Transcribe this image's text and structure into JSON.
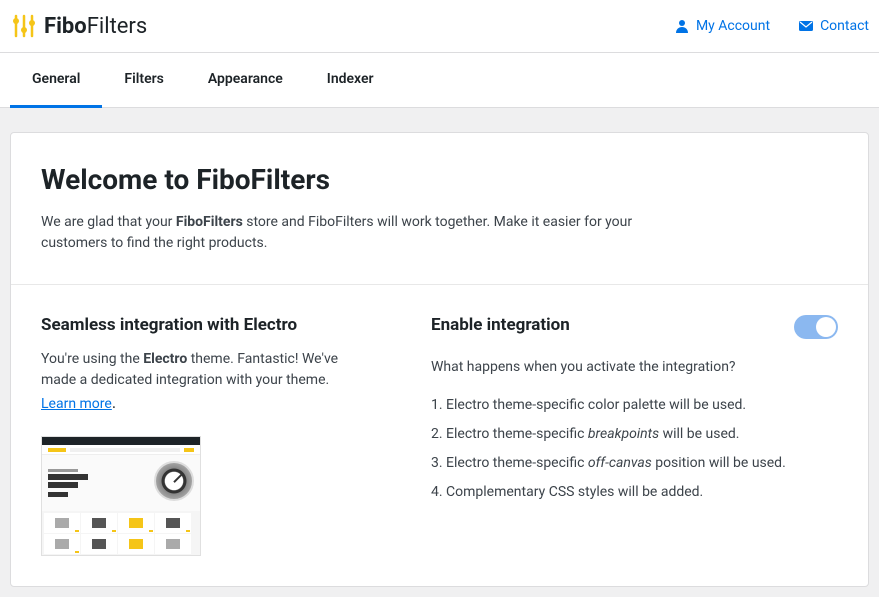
{
  "header": {
    "logo_bold": "Fibo",
    "logo_light": "Filters",
    "links": {
      "account": "My Account",
      "contact": "Contact"
    }
  },
  "tabs": [
    {
      "label": "General",
      "active": true
    },
    {
      "label": "Filters",
      "active": false
    },
    {
      "label": "Appearance",
      "active": false
    },
    {
      "label": "Indexer",
      "active": false
    }
  ],
  "welcome": {
    "title": "Welcome to FiboFilters",
    "text_before": "We are glad that your ",
    "text_bold": "FiboFilters",
    "text_after": " store and FiboFilters will work together. Make it easier for your customers to find the right products."
  },
  "integration": {
    "heading": "Seamless integration with Electro",
    "text_before": "You're using the ",
    "text_bold": "Electro",
    "text_after": " theme. Fantastic! We've made a dedicated integration with your theme.",
    "learn_more": "Learn more",
    "period": "."
  },
  "enable": {
    "heading": "Enable integration",
    "subtext": "What happens when you activate the integration?",
    "toggle_on": true,
    "items": [
      {
        "prefix": "Electro theme-specific color palette will be used.",
        "em": "",
        "suffix": ""
      },
      {
        "prefix": "Electro theme-specific ",
        "em": "breakpoints",
        "suffix": " will be used."
      },
      {
        "prefix": "Electro theme-specific ",
        "em": "off-canvas",
        "suffix": " position will be used."
      },
      {
        "prefix": "Complementary CSS styles will be added.",
        "em": "",
        "suffix": ""
      }
    ]
  },
  "colors": {
    "accent": "#0073e6",
    "brand_yellow": "#f5c518"
  }
}
